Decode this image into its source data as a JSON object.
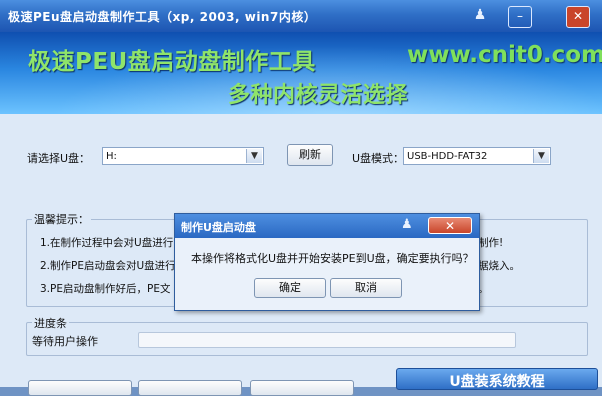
{
  "window": {
    "title": "极速PEu盘启动盘制作工具（xp, 2003, win7内核）",
    "minimize_label": "–",
    "close_label": "✕"
  },
  "banner": {
    "line1": "极速PEU盘启动盘制作工具",
    "url": "www.cnit0.com",
    "line2": "多种内核灵活选择"
  },
  "controls": {
    "drive_label": "请选择U盘：",
    "drive_value": "H:",
    "refresh_label": "刷新",
    "mode_label": "U盘模式：",
    "mode_value": "USB-HDD-FAT32"
  },
  "tips": {
    "title": "温馨提示：",
    "items": [
      "1.在制作过程中会对U盘进行",
      "2.制作PE启动盘会对U盘进行",
      "3.PE启动盘制作好后，PE文"
    ],
    "right_fragments": [
      "制作!",
      "据烧入。",
      "。"
    ]
  },
  "progress": {
    "title": "进度条",
    "status": "等待用户操作"
  },
  "big_button_label": "U盘装系统教程",
  "dialog": {
    "title": "制作U盘启动盘",
    "message": "本操作将格式化U盘并开始安装PE到U盘，确定要执行吗？",
    "ok_label": "确定",
    "cancel_label": "取消",
    "close_label": "✕"
  },
  "colors": {
    "title_bar": "#2f6fc6",
    "banner_text": "#8fe46a",
    "body_bg": "#dde9f7",
    "close_button": "#c9452a"
  }
}
